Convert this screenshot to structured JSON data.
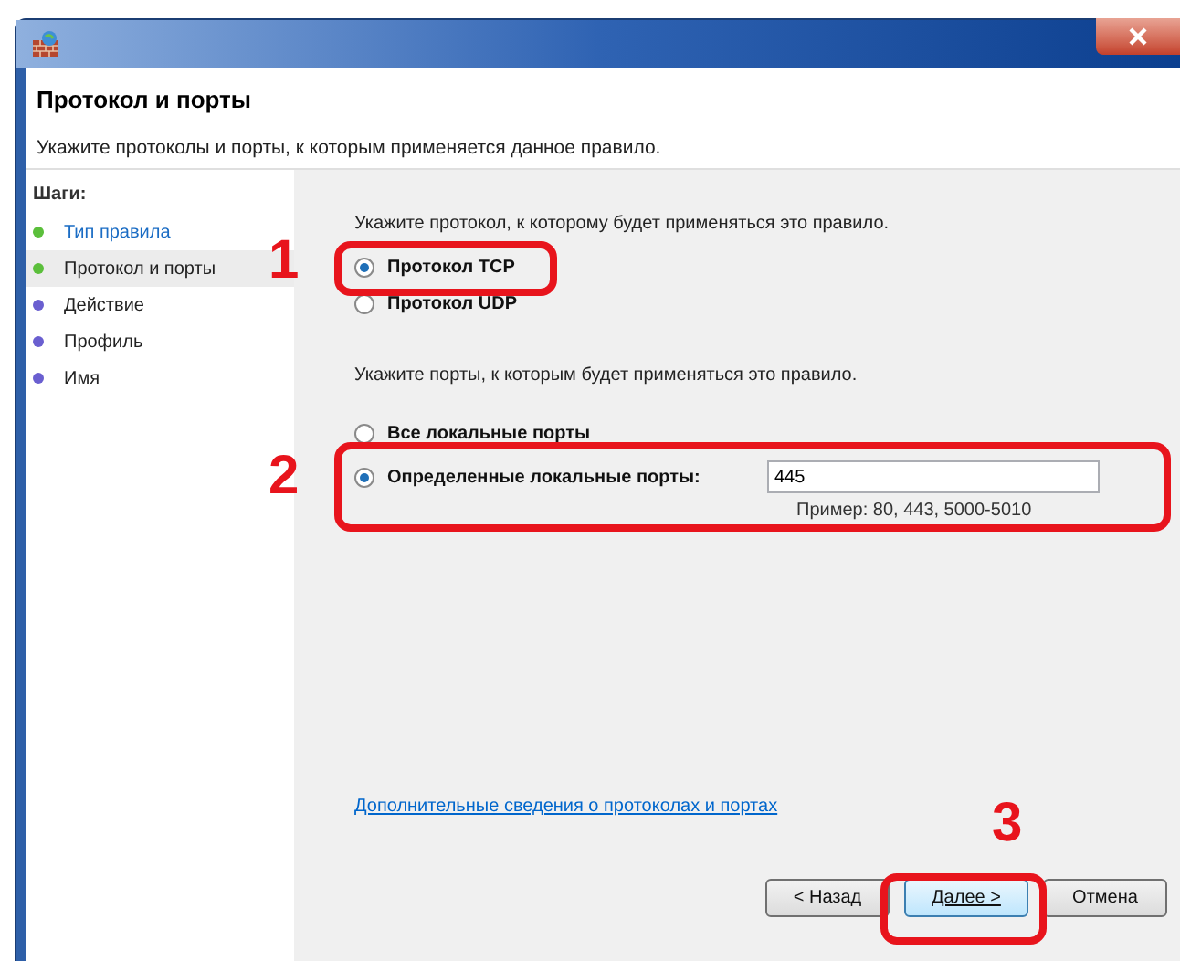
{
  "header": {
    "title": "Протокол и порты",
    "subtitle": "Укажите протоколы и порты, к которым применяется данное правило."
  },
  "steps": {
    "heading": "Шаги:",
    "items": [
      {
        "label": "Тип правила",
        "completed": true,
        "selected": false
      },
      {
        "label": "Протокол и порты",
        "completed": true,
        "selected": true
      },
      {
        "label": "Действие",
        "completed": false,
        "selected": false
      },
      {
        "label": "Профиль",
        "completed": false,
        "selected": false
      },
      {
        "label": "Имя",
        "completed": false,
        "selected": false
      }
    ]
  },
  "protocol": {
    "prompt": "Укажите протокол, к которому будет применяться это правило.",
    "options": [
      {
        "label": "Протокол TCP",
        "selected": true
      },
      {
        "label": "Протокол UDP",
        "selected": false
      }
    ]
  },
  "ports": {
    "prompt": "Укажите порты, к которым будет применяться это правило.",
    "options": [
      {
        "label": "Все локальные порты",
        "selected": false
      },
      {
        "label": "Определенные локальные порты:",
        "selected": true
      }
    ],
    "value": "445",
    "hint": "Пример: 80, 443, 5000-5010"
  },
  "link": "Дополнительные сведения о протоколах и портах",
  "buttons": [
    {
      "label": "< Назад",
      "focused": false
    },
    {
      "label": "Далее >",
      "focused": true
    },
    {
      "label": "Отмена",
      "focused": false
    }
  ],
  "callouts": [
    "1",
    "2",
    "3"
  ]
}
